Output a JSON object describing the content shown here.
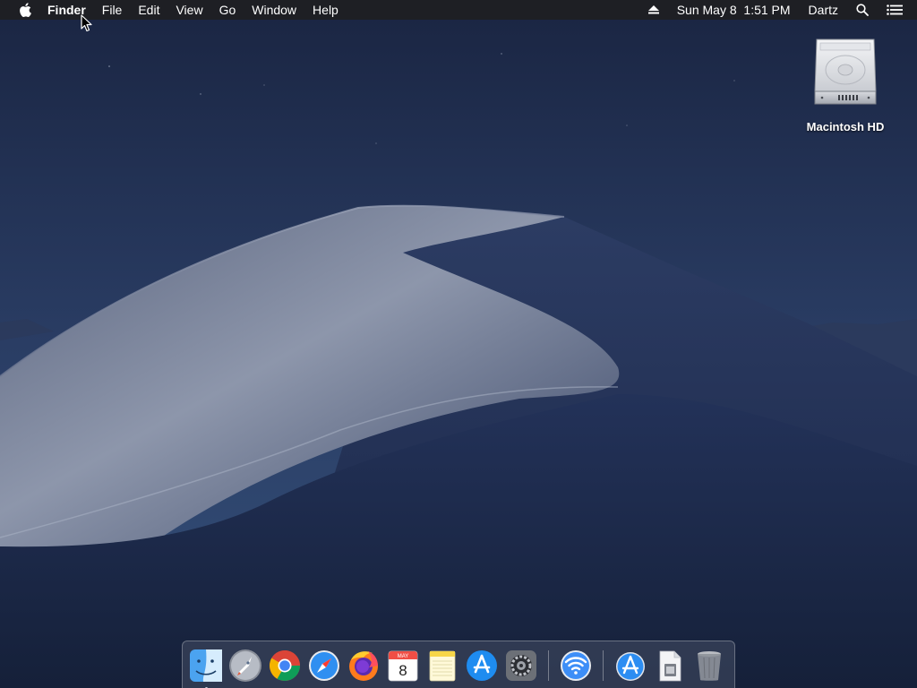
{
  "menubar": {
    "apple_icon": "apple-icon",
    "app_name": "Finder",
    "menus": [
      "File",
      "Edit",
      "View",
      "Go",
      "Window",
      "Help"
    ],
    "status": {
      "eject_icon": "eject-icon",
      "datetime": "Sun May 8  1:51 PM",
      "user": "Dartz",
      "spotlight_icon": "spotlight-icon",
      "notification_icon": "notification-center-icon"
    }
  },
  "desktop": {
    "icons": [
      {
        "label": "Macintosh HD",
        "icon": "hard-drive-icon"
      }
    ]
  },
  "dock": {
    "apps": [
      {
        "name": "Finder",
        "icon": "finder-icon",
        "running": true
      },
      {
        "name": "Launchpad",
        "icon": "launchpad-icon",
        "running": false
      },
      {
        "name": "Google Chrome",
        "icon": "chrome-icon",
        "running": false
      },
      {
        "name": "Safari",
        "icon": "safari-icon",
        "running": false
      },
      {
        "name": "Firefox",
        "icon": "firefox-icon",
        "running": false
      },
      {
        "name": "Calendar",
        "icon": "calendar-icon",
        "running": false,
        "month": "MAY",
        "day": "8"
      },
      {
        "name": "Notes",
        "icon": "notes-icon",
        "running": false
      },
      {
        "name": "App Store",
        "icon": "app-store-icon",
        "running": false
      },
      {
        "name": "System Preferences",
        "icon": "system-preferences-icon",
        "running": false
      },
      {
        "name": "Wireless Diagnostics",
        "icon": "wifi-icon",
        "running": false
      },
      {
        "name": "Applications",
        "icon": "applications-folder-icon",
        "running": false
      },
      {
        "name": "Downloads",
        "icon": "downloads-icon",
        "running": false
      },
      {
        "name": "Trash",
        "icon": "trash-icon",
        "running": false
      }
    ]
  },
  "colors": {
    "menubar_bg": "#1e1e22",
    "sky_top": "#1c2845",
    "dune_light": "#8a93a8",
    "dune_shadow": "#1f2d52"
  }
}
